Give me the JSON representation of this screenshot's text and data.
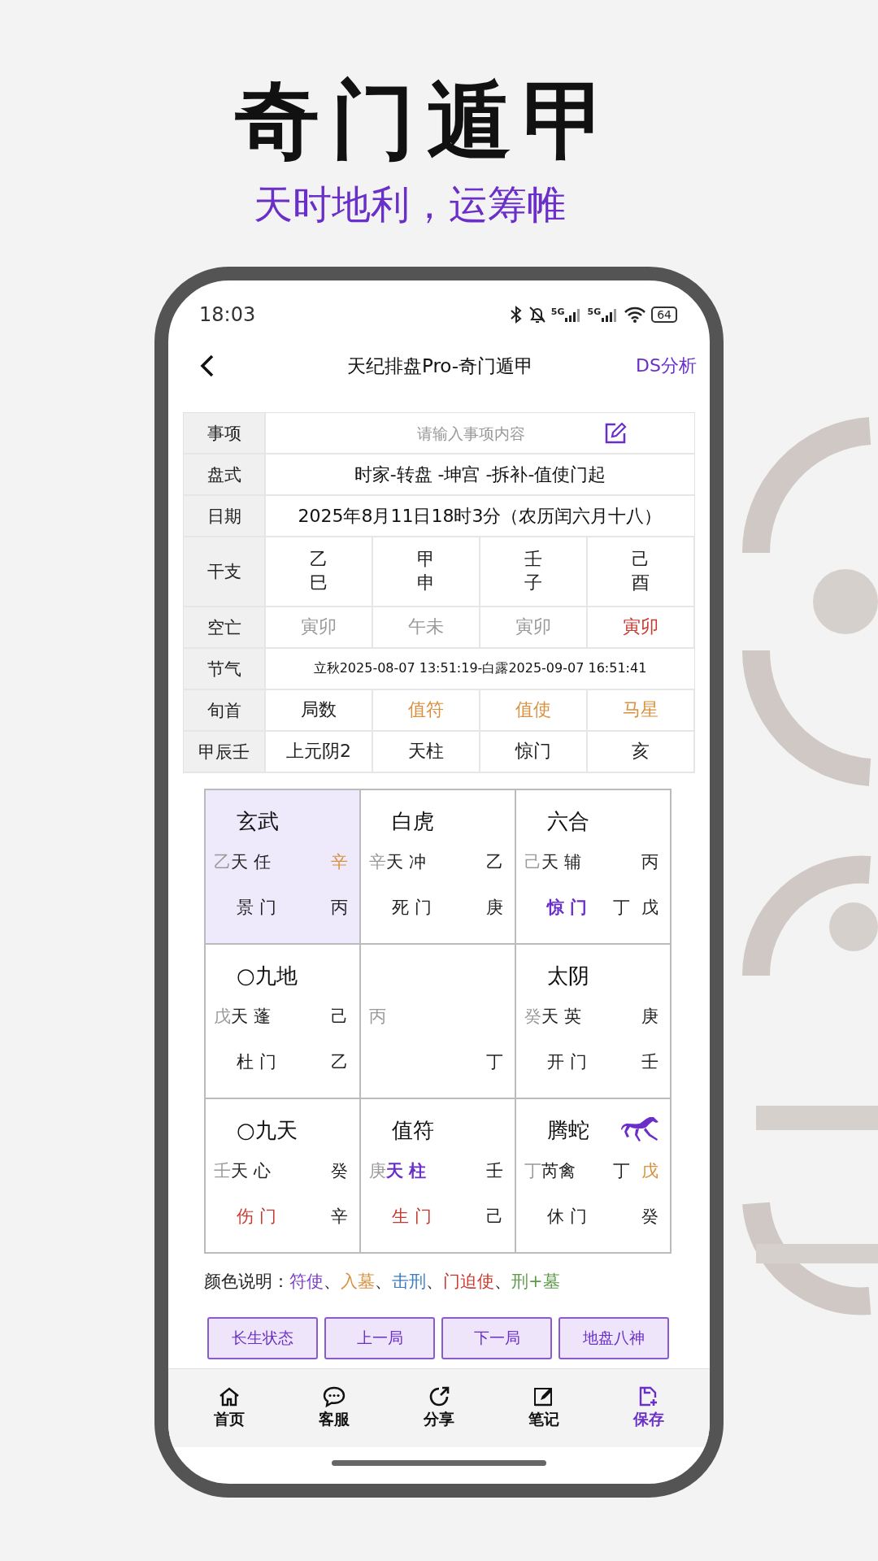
{
  "headline": {
    "title": "奇门遁甲",
    "subtitle": "天时地利，运筹帷"
  },
  "status_bar": {
    "time": "18:03",
    "network_labels": [
      "5G",
      "5G"
    ],
    "battery": "64"
  },
  "nav_bar": {
    "title": "天纪排盘Pro-奇门遁甲",
    "action": "DS分析"
  },
  "info_table": {
    "rows": [
      {
        "kind": "input",
        "label": "事项",
        "placeholder": "请输入事项内容"
      },
      {
        "kind": "wide",
        "label": "盘式",
        "value": "时家-转盘 -坤宫 -拆补-值使门起"
      },
      {
        "kind": "wide",
        "label": "日期",
        "value": "2025年8月11日18时3分（农历闰六月十八）"
      },
      {
        "kind": "quad",
        "label": "干支",
        "cells": [
          {
            "lines": [
              "乙",
              "巳"
            ]
          },
          {
            "lines": [
              "甲",
              "申"
            ]
          },
          {
            "lines": [
              "壬",
              "子"
            ]
          },
          {
            "lines": [
              "己",
              "酉"
            ]
          }
        ]
      },
      {
        "kind": "quad",
        "label": "空亡",
        "cells": [
          {
            "lines": [
              "寅卯"
            ],
            "color": "#9a9a9a"
          },
          {
            "lines": [
              "午未"
            ],
            "color": "#9a9a9a"
          },
          {
            "lines": [
              "寅卯"
            ],
            "color": "#9a9a9a"
          },
          {
            "lines": [
              "寅卯"
            ],
            "color": "#c8392f"
          }
        ]
      },
      {
        "kind": "fine",
        "label": "节气",
        "value": "立秋2025-08-07 13:51:19-白露2025-09-07 16:51:41"
      },
      {
        "kind": "quad",
        "label": "旬首",
        "cells": [
          {
            "lines": [
              "局数"
            ]
          },
          {
            "lines": [
              "值符"
            ],
            "color": "#d9913f"
          },
          {
            "lines": [
              "值使"
            ],
            "color": "#d9913f"
          },
          {
            "lines": [
              "马星"
            ],
            "color": "#d9913f"
          }
        ]
      },
      {
        "kind": "quad",
        "label": "甲辰壬",
        "cells": [
          {
            "lines": [
              "上元阴2"
            ]
          },
          {
            "lines": [
              "天柱"
            ]
          },
          {
            "lines": [
              "惊门"
            ]
          },
          {
            "lines": [
              "亥"
            ]
          }
        ]
      }
    ]
  },
  "palace_rows": [
    [
      {
        "god": "玄武",
        "selected": true,
        "horse": false,
        "stem": "乙",
        "star": {
          "text": "天 任"
        },
        "star_side": [
          {
            "text": "辛",
            "color": "#d9913f"
          }
        ],
        "door": {
          "text": "景 门"
        },
        "door_side": [
          {
            "text": "丙"
          }
        ]
      },
      {
        "god": "白虎",
        "selected": false,
        "horse": false,
        "stem": "辛",
        "star": {
          "text": "天 冲"
        },
        "star_side": [
          {
            "text": "乙"
          }
        ],
        "door": {
          "text": "死 门"
        },
        "door_side": [
          {
            "text": "庚"
          }
        ]
      },
      {
        "god": "六合",
        "selected": false,
        "horse": false,
        "stem": "己",
        "star": {
          "text": "天 辅"
        },
        "star_side": [
          {
            "text": "丙"
          }
        ],
        "door": {
          "text": "惊 门",
          "color": "#6a2fc9",
          "bold": true
        },
        "door_side": [
          {
            "text": "丁"
          },
          {
            "text": "戊"
          }
        ]
      }
    ],
    [
      {
        "god": "○九地",
        "selected": false,
        "horse": false,
        "stem": "戊",
        "star": {
          "text": "天 蓬"
        },
        "star_side": [
          {
            "text": "己"
          }
        ],
        "door": {
          "text": "杜 门"
        },
        "door_side": [
          {
            "text": "乙"
          }
        ]
      },
      {
        "selected": false,
        "horse": false,
        "stem": "丙",
        "door_side": [
          {
            "text": "丁"
          }
        ]
      },
      {
        "god": "太阴",
        "selected": false,
        "horse": false,
        "stem": "癸",
        "star": {
          "text": "天 英"
        },
        "star_side": [
          {
            "text": "庚"
          }
        ],
        "door": {
          "text": "开 门"
        },
        "door_side": [
          {
            "text": "壬"
          }
        ]
      }
    ],
    [
      {
        "god": "○九天",
        "selected": false,
        "horse": false,
        "stem": "壬",
        "star": {
          "text": "天 心"
        },
        "star_side": [
          {
            "text": "癸"
          }
        ],
        "door": {
          "text": "伤 门",
          "color": "#c8392f"
        },
        "door_side": [
          {
            "text": "辛"
          }
        ]
      },
      {
        "god": "值符",
        "selected": false,
        "horse": false,
        "stem": "庚",
        "star": {
          "text": "天 柱",
          "color": "#6a2fc9",
          "bold": true
        },
        "star_side": [
          {
            "text": "壬"
          }
        ],
        "door": {
          "text": "生 门",
          "color": "#c8392f"
        },
        "door_side": [
          {
            "text": "己"
          }
        ]
      },
      {
        "god": "腾蛇",
        "selected": false,
        "horse": true,
        "stem": "丁",
        "star": {
          "text": "芮禽"
        },
        "star_side": [
          {
            "text": "丁"
          },
          {
            "text": "戊",
            "color": "#d9913f"
          }
        ],
        "door": {
          "text": "休 门"
        },
        "door_side": [
          {
            "text": "癸"
          }
        ]
      }
    ]
  ],
  "legend": {
    "label": "颜色说明：",
    "parts": [
      {
        "kind": "term",
        "text": "符使",
        "color": "#7b3fc4"
      },
      {
        "kind": "separator",
        "text": "、"
      },
      {
        "kind": "term",
        "text": "入墓",
        "color": "#d9913f"
      },
      {
        "kind": "separator",
        "text": "、"
      },
      {
        "kind": "term",
        "text": "击刑",
        "color": "#3b7cc4"
      },
      {
        "kind": "separator",
        "text": "、"
      },
      {
        "kind": "term",
        "text": "门迫使",
        "color": "#c8392f"
      },
      {
        "kind": "separator",
        "text": "、"
      },
      {
        "kind": "term",
        "text": "刑+墓",
        "color": "#5a9a48"
      }
    ]
  },
  "actions": [
    "长生状态",
    "上一局",
    "下一局",
    "地盘八神"
  ],
  "tab_bar": [
    {
      "label": "首页",
      "selected": false
    },
    {
      "label": "客服",
      "selected": false
    },
    {
      "label": "分享",
      "selected": false
    },
    {
      "label": "笔记",
      "selected": false
    },
    {
      "label": "保存",
      "selected": true
    }
  ]
}
